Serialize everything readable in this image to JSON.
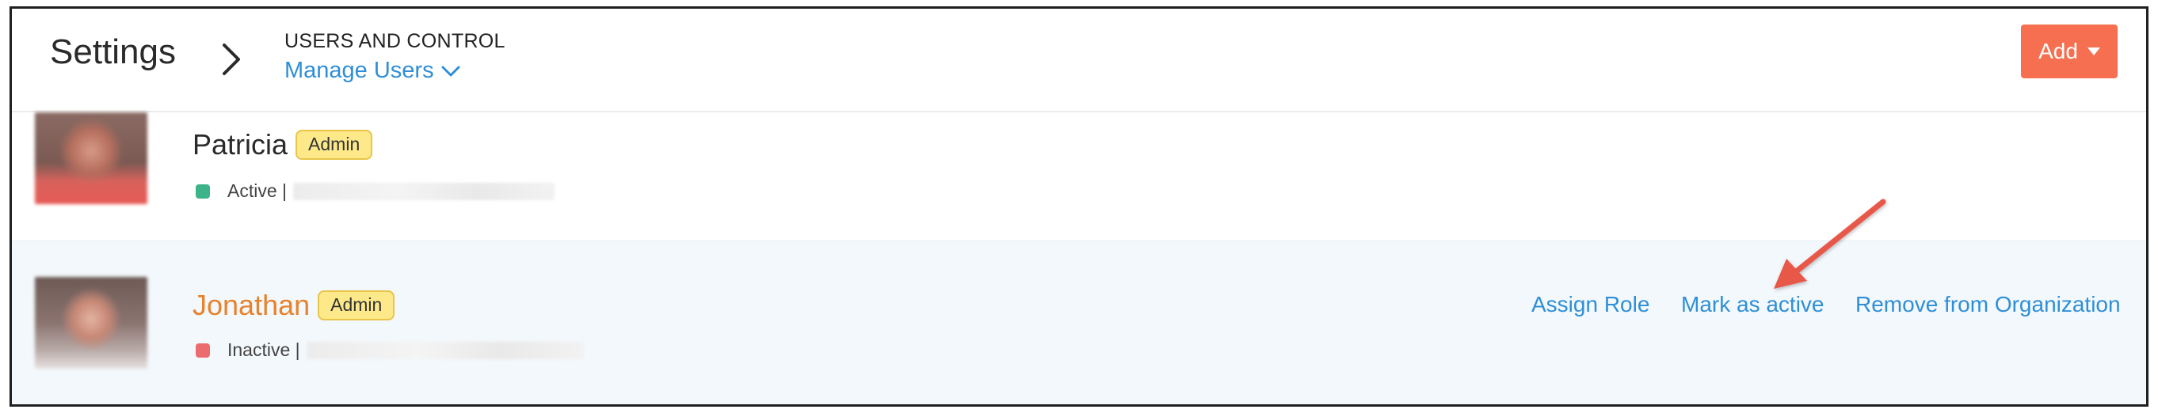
{
  "header": {
    "title": "Settings",
    "breadcrumb_section": "USERS AND CONTROL",
    "breadcrumb_page": "Manage Users",
    "add_label": "Add"
  },
  "users": [
    {
      "name": "Patricia",
      "role": "Admin",
      "status": "Active |",
      "status_color": "#3db389"
    },
    {
      "name": "Jonathan",
      "role": "Admin",
      "status": "Inactive |",
      "status_color": "#ec6b6f",
      "actions": {
        "assign_role": "Assign Role",
        "mark_active": "Mark as active",
        "remove": "Remove from Organization"
      }
    }
  ],
  "colors": {
    "accent_link": "#2f8fd6",
    "add_button": "#f56f50",
    "highlight_name": "#e8822c",
    "badge_fill": "#fde98a",
    "row_hover": "#f3f8fc",
    "annotation": "#e8584a"
  },
  "icons": {
    "breadcrumb_separator": "chevron-right-icon",
    "page_dropdown": "chevron-down-icon",
    "add_dropdown": "caret-down-icon",
    "annotation": "arrow-icon"
  }
}
